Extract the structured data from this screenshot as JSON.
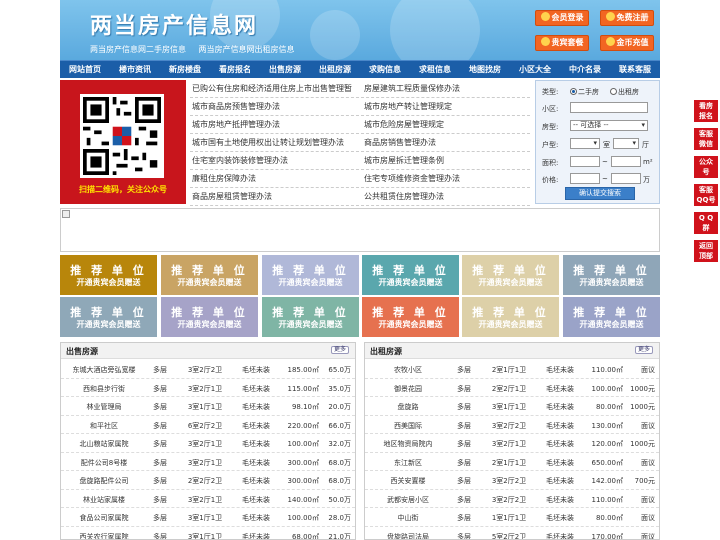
{
  "header": {
    "title": "两当房产信息网",
    "sub1": "两当房产信息网二手房信息",
    "sub2": "两当房产信息网出租房信息",
    "buttons": [
      {
        "label": "会员登录"
      },
      {
        "label": "免费注册"
      },
      {
        "label": "贵宾套餐"
      },
      {
        "label": "金币充值"
      }
    ]
  },
  "nav": [
    "网站首页",
    "楼市资讯",
    "新房楼盘",
    "看房报名",
    "出售房源",
    "出租房源",
    "求购信息",
    "求租信息",
    "地图找房",
    "小区大全",
    "中介名录",
    "联系客服"
  ],
  "qr": {
    "caption": "扫描二维码，关注公众号"
  },
  "links": [
    [
      "已购公有住房和经济适用住房上市出售管理暂",
      "房屋建筑工程质量保修办法"
    ],
    [
      "城市商品房预售管理办法",
      "城市房地产转让管理规定"
    ],
    [
      "城市房地产抵押管理办法",
      "城市危险房屋管理规定"
    ],
    [
      "城市国有土地使用权出让转让规划管理办法",
      "商品房销售管理办法"
    ],
    [
      "住宅室内装饰装修管理办法",
      "城市房屋拆迁管理条例"
    ],
    [
      "廉租住房保障办法",
      "住宅专项维修资金管理办法"
    ],
    [
      "商品房屋租赁管理办法",
      "公共租赁住房管理办法"
    ]
  ],
  "search": {
    "type_label": "类型:",
    "type_opt1": "二手房",
    "type_opt2": "出租房",
    "community_label": "小区:",
    "housetype_label": "房型:",
    "housetype_value": "-- 可选择 --",
    "layout_label": "户型:",
    "room_unit": "室",
    "hall_unit": "厅",
    "area_label": "面积:",
    "area_unit": "m²",
    "price_label": "价格:",
    "price_unit": "万",
    "tilde": "~",
    "submit": "确认提交搜索"
  },
  "ads": {
    "line1": "推 荐 单 位",
    "line2": "开通贵宾会员赠送",
    "colors": [
      "#b8860b",
      "#c9a464",
      "#b0b8d8",
      "#5aa7ad",
      "#ddd0a8",
      "#8fa6b8",
      "#8fa8b8",
      "#a6a3c8",
      "#7fb5a5",
      "#e6714f",
      "#ddd0a8",
      "#9aa3c8"
    ]
  },
  "sale": {
    "title": "出售房源",
    "more": "更多",
    "rows": [
      [
        "东城大酒店旁弘宽楼",
        "多层",
        "3室2厅2卫",
        "毛坯未装",
        "185.00㎡",
        "65.0万"
      ],
      [
        "西和县步行街",
        "多层",
        "3室2厅1卫",
        "毛坯未装",
        "115.00㎡",
        "35.0万"
      ],
      [
        "林业管理局",
        "多层",
        "3室1厅1卫",
        "毛坯未装",
        "98.10㎡",
        "20.0万"
      ],
      [
        "和平社区",
        "多层",
        "6室2厅2卫",
        "毛坯未装",
        "220.00㎡",
        "66.0万"
      ],
      [
        "北山粮站家属院",
        "多层",
        "3室2厅1卫",
        "毛坯未装",
        "100.00㎡",
        "32.0万"
      ],
      [
        "配件公司8号楼",
        "多层",
        "3室2厅1卫",
        "毛坯未装",
        "300.00㎡",
        "68.0万"
      ],
      [
        "盘旋路配件公司",
        "多层",
        "2室2厅2卫",
        "毛坯未装",
        "300.00㎡",
        "68.0万"
      ],
      [
        "林业站家属楼",
        "多层",
        "3室2厅1卫",
        "毛坯未装",
        "140.00㎡",
        "50.0万"
      ],
      [
        "食品公司家属院",
        "多层",
        "3室1厅1卫",
        "毛坯未装",
        "100.00㎡",
        "28.0万"
      ],
      [
        "西关农行家属院",
        "多层",
        "3室1厅1卫",
        "毛坯未装",
        "68.00㎡",
        "21.0万"
      ]
    ]
  },
  "rent": {
    "title": "出租房源",
    "more": "更多",
    "rows": [
      [
        "农牧小区",
        "多层",
        "2室1厅1卫",
        "毛坯未装",
        "110.00㎡",
        "面议"
      ],
      [
        "御景花园",
        "多层",
        "2室2厅1卫",
        "毛坯未装",
        "100.00㎡",
        "1000元"
      ],
      [
        "盘旋路",
        "多层",
        "3室1厅1卫",
        "毛坯未装",
        "80.00㎡",
        "1000元"
      ],
      [
        "西美国际",
        "多层",
        "3室2厅2卫",
        "毛坯未装",
        "130.00㎡",
        "面议"
      ],
      [
        "地区物资局院内",
        "多层",
        "3室2厅1卫",
        "毛坯未装",
        "120.00㎡",
        "1000元"
      ],
      [
        "东江新区",
        "多层",
        "2室1厅1卫",
        "毛坯未装",
        "650.00㎡",
        "面议"
      ],
      [
        "西关安置楼",
        "多层",
        "3室2厅2卫",
        "毛坯未装",
        "142.00㎡",
        "700元"
      ],
      [
        "武都安居小区",
        "多层",
        "3室2厅2卫",
        "毛坯未装",
        "110.00㎡",
        "面议"
      ],
      [
        "中山街",
        "多层",
        "1室1厅1卫",
        "毛坯未装",
        "80.00㎡",
        "面议"
      ],
      [
        "盘旋路司法局",
        "多层",
        "5室2厅2卫",
        "毛坯未装",
        "170.00㎡",
        "面议"
      ]
    ]
  },
  "sidebar": [
    {
      "l1": "看房",
      "l2": "报名"
    },
    {
      "l1": "客服",
      "l2": "微信"
    },
    {
      "l1": "公众",
      "l2": "号"
    },
    {
      "l1": "客服",
      "l2": "QQ号"
    },
    {
      "l1": "Q Q",
      "l2": "群"
    },
    {
      "l1": "返回",
      "l2": "顶部"
    }
  ]
}
